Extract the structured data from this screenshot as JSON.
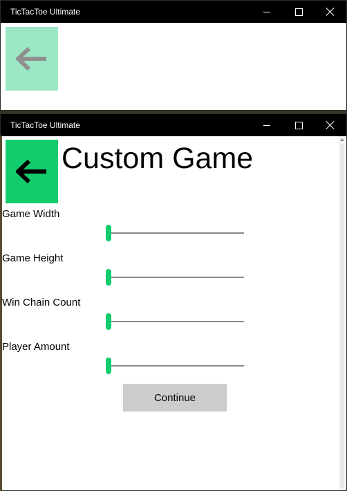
{
  "back_window": {
    "title": "TicTacToe Ultimate"
  },
  "front_window": {
    "title": "TicTacToe Ultimate"
  },
  "page": {
    "title": "Custom Game",
    "settings": [
      {
        "label": "Game Width",
        "value": 0
      },
      {
        "label": "Game Height",
        "value": 0
      },
      {
        "label": "Win Chain Count",
        "value": 0
      },
      {
        "label": "Player Amount",
        "value": 0
      }
    ],
    "continue_label": "Continue"
  },
  "icons": {
    "back": "arrow-left-icon",
    "minimize": "minimize-icon",
    "maximize": "maximize-icon",
    "close": "close-icon"
  },
  "colors": {
    "accent": "#12cc6d",
    "accent_faded": "#9ce8c5",
    "titlebar": "#000000",
    "button": "#cccccc"
  }
}
